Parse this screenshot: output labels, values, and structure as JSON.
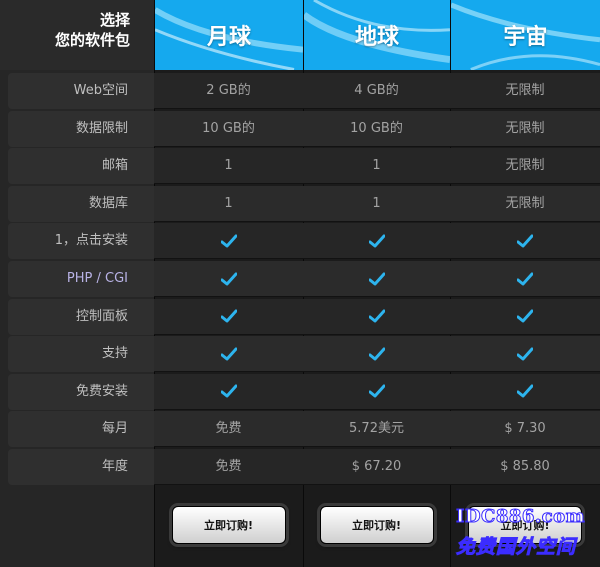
{
  "header": {
    "title_line1": "选择",
    "title_line2": "您的软件包"
  },
  "plans": [
    {
      "name": "月球",
      "button": "立即订购!"
    },
    {
      "name": "地球",
      "button": "立即订购!"
    },
    {
      "name": "宇宙",
      "button": "立即订购!"
    }
  ],
  "rows": [
    {
      "label": "Web空间",
      "values": [
        "2 GB的",
        "4 GB的",
        "无限制"
      ]
    },
    {
      "label": "数据限制",
      "values": [
        "10 GB的",
        "10 GB的",
        "无限制"
      ]
    },
    {
      "label": "邮箱",
      "values": [
        "1",
        "1",
        "无限制"
      ]
    },
    {
      "label": "数据库",
      "values": [
        "1",
        "1",
        "无限制"
      ]
    },
    {
      "label": "1，点击安装",
      "values": [
        "check",
        "check",
        "check"
      ]
    },
    {
      "label": "PHP / CGI",
      "values": [
        "check",
        "check",
        "check"
      ]
    },
    {
      "label": "控制面板",
      "values": [
        "check",
        "check",
        "check"
      ]
    },
    {
      "label": "支持",
      "values": [
        "check",
        "check",
        "check"
      ]
    },
    {
      "label": "免费安装",
      "values": [
        "check",
        "check",
        "check"
      ]
    },
    {
      "label": "每月",
      "values": [
        "免费",
        "5.72美元",
        "$ 7.30"
      ]
    },
    {
      "label": "年度",
      "values": [
        "免费",
        "$ 67.20",
        "$ 85.80"
      ]
    }
  ],
  "watermark": {
    "line1": "IDC886.com",
    "line2": "免费国外空间"
  },
  "colors": {
    "accent": "#15a9ee",
    "check": "#2db4ee",
    "label_php": "#b9b3e6"
  }
}
